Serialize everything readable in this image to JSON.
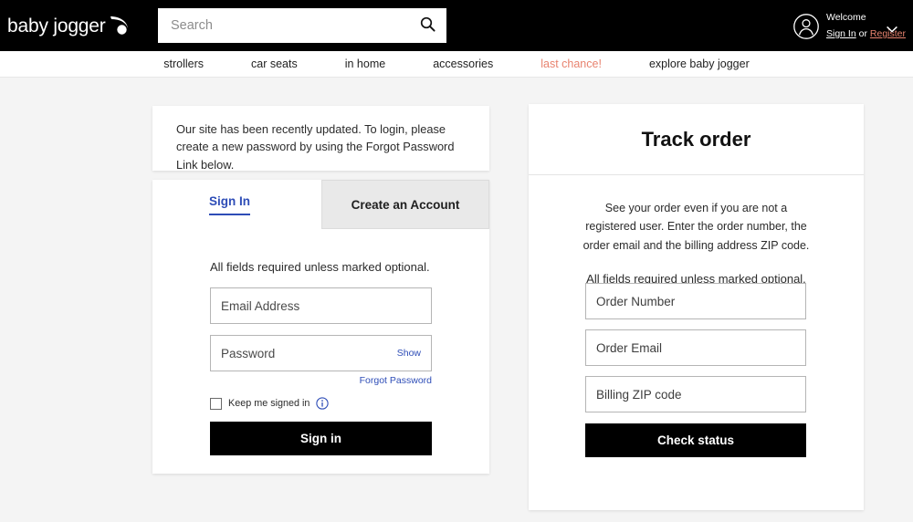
{
  "brand": {
    "logo_text": "baby jogger",
    "logo_icon": "swoosh-icon"
  },
  "colors": {
    "accent_coral": "#e8836f",
    "link_blue": "#2e4db7",
    "topbar_black": "#000000",
    "page_background": "#f4f4f4"
  },
  "header": {
    "search": {
      "placeholder": "Search",
      "value": "",
      "icon": "search-icon"
    },
    "account": {
      "avatar_icon": "user-circle-icon",
      "welcome": "Welcome",
      "sign_in": "Sign In",
      "or": "or",
      "register": "Register",
      "chevron_icon": "chevron-down-icon"
    }
  },
  "nav": {
    "items": [
      {
        "label": "strollers",
        "accent": false
      },
      {
        "label": "car seats",
        "accent": false
      },
      {
        "label": "in home",
        "accent": false
      },
      {
        "label": "accessories",
        "accent": false
      },
      {
        "label": "last chance!",
        "accent": true
      },
      {
        "label": "explore baby jogger",
        "accent": false
      }
    ]
  },
  "notice": {
    "message": "Our site has been recently updated. To login, please create a new password by using the Forgot Password Link below."
  },
  "signin": {
    "tabs": {
      "sign_in": "Sign In",
      "create_account": "Create an Account",
      "active": "Sign In"
    },
    "required_note": "All fields required unless marked optional.",
    "email": {
      "placeholder": "Email Address",
      "value": ""
    },
    "password": {
      "placeholder": "Password",
      "value": "",
      "show_label": "Show"
    },
    "forgot_password": "Forgot Password",
    "keep_signed_in": {
      "label": "Keep me signed in",
      "checked": false,
      "info_icon": "info-circle-icon"
    },
    "submit_label": "Sign in"
  },
  "track_order": {
    "title": "Track order",
    "description": "See your order even if you are not a registered user. Enter the order number, the order email and the billing address ZIP code.",
    "required_note": "All fields required unless marked optional.",
    "order_number": {
      "placeholder": "Order Number",
      "value": ""
    },
    "order_email": {
      "placeholder": "Order Email",
      "value": ""
    },
    "billing_zip": {
      "placeholder": "Billing ZIP code",
      "value": ""
    },
    "submit_label": "Check status"
  }
}
